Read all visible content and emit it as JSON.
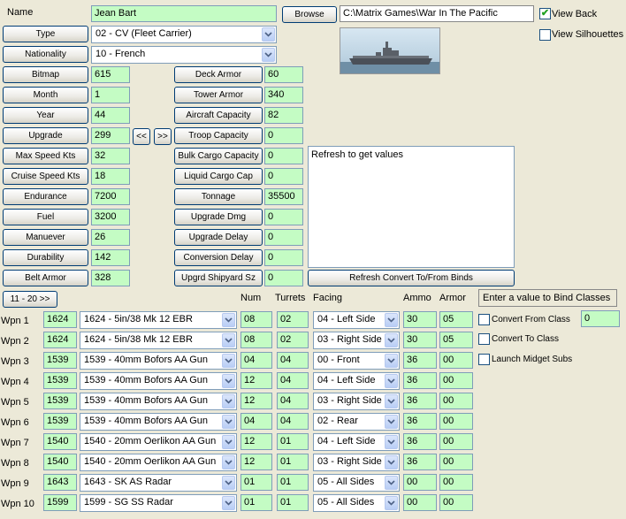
{
  "header": {
    "name_label": "Name",
    "name_value": "Jean Bart",
    "browse_label": "Browse",
    "path_value": "C:\\Matrix Games\\War In The Pacific",
    "view_back_label": "View Back",
    "view_back_checked": true,
    "view_silhouettes_label": "View Silhouettes",
    "view_silhouettes_checked": false
  },
  "type": {
    "label": "Type",
    "value": "02 - CV (Fleet Carrier)"
  },
  "nationality": {
    "label": "Nationality",
    "value": "10 - French"
  },
  "left_fields": [
    {
      "label": "Bitmap",
      "value": "615"
    },
    {
      "label": "Month",
      "value": "1"
    },
    {
      "label": "Year",
      "value": "44"
    },
    {
      "label": "Upgrade",
      "value": "299"
    },
    {
      "label": "Max Speed Kts",
      "value": "32"
    },
    {
      "label": "Cruise Speed Kts",
      "value": "18"
    },
    {
      "label": "Endurance",
      "value": "7200"
    },
    {
      "label": "Fuel",
      "value": "3200"
    },
    {
      "label": "Manuever",
      "value": "26"
    },
    {
      "label": "Durability",
      "value": "142"
    },
    {
      "label": "Belt Armor",
      "value": "328"
    }
  ],
  "upgrade_nav": {
    "prev": "<<",
    "next": ">>"
  },
  "mid_fields": [
    {
      "label": "Deck Armor",
      "value": "60"
    },
    {
      "label": "Tower Armor",
      "value": "340"
    },
    {
      "label": "Aircraft Capacity",
      "value": "82"
    },
    {
      "label": "Troop Capacity",
      "value": "0"
    },
    {
      "label": "Bulk Cargo Capacity",
      "value": "0"
    },
    {
      "label": "Liquid Cargo Cap",
      "value": "0"
    },
    {
      "label": "Tonnage",
      "value": "35500"
    },
    {
      "label": "Upgrade Dmg",
      "value": "0"
    },
    {
      "label": "Upgrade Delay",
      "value": "0"
    },
    {
      "label": "Conversion Delay",
      "value": "0"
    },
    {
      "label": "Upgrd Shipyard Sz",
      "value": "0"
    }
  ],
  "info_box": {
    "text": "Refresh to get values"
  },
  "refresh_button": "Refresh Convert To/From Binds",
  "page_button": "11 - 20 >>",
  "columns": {
    "num": "Num",
    "turrets": "Turrets",
    "facing": "Facing",
    "ammo": "Ammo",
    "armor": "Armor"
  },
  "bind_box": {
    "label": "Enter a value to Bind Classes",
    "convert_from": "Convert From Class",
    "convert_from_value": "0",
    "convert_to": "Convert To Class",
    "launch_midget": "Launch Midget Subs"
  },
  "weapons": [
    {
      "label": "Wpn 1",
      "id": "1624",
      "name": "1624 - 5in/38 Mk 12 EBR",
      "num": "08",
      "turrets": "02",
      "facing": "04 - Left Side",
      "ammo": "30",
      "armor": "05"
    },
    {
      "label": "Wpn 2",
      "id": "1624",
      "name": "1624 - 5in/38 Mk 12 EBR",
      "num": "08",
      "turrets": "02",
      "facing": "03 - Right Side",
      "ammo": "30",
      "armor": "05"
    },
    {
      "label": "Wpn 3",
      "id": "1539",
      "name": "1539 - 40mm Bofors AA Gun",
      "num": "04",
      "turrets": "04",
      "facing": "00 - Front",
      "ammo": "36",
      "armor": "00"
    },
    {
      "label": "Wpn 4",
      "id": "1539",
      "name": "1539 - 40mm Bofors AA Gun",
      "num": "12",
      "turrets": "04",
      "facing": "04 - Left Side",
      "ammo": "36",
      "armor": "00"
    },
    {
      "label": "Wpn 5",
      "id": "1539",
      "name": "1539 - 40mm Bofors AA Gun",
      "num": "12",
      "turrets": "04",
      "facing": "03 - Right Side",
      "ammo": "36",
      "armor": "00"
    },
    {
      "label": "Wpn 6",
      "id": "1539",
      "name": "1539 - 40mm Bofors AA Gun",
      "num": "04",
      "turrets": "04",
      "facing": "02 - Rear",
      "ammo": "36",
      "armor": "00"
    },
    {
      "label": "Wpn 7",
      "id": "1540",
      "name": "1540 - 20mm Oerlikon AA Gun",
      "num": "12",
      "turrets": "01",
      "facing": "04 - Left Side",
      "ammo": "36",
      "armor": "00"
    },
    {
      "label": "Wpn 8",
      "id": "1540",
      "name": "1540 - 20mm Oerlikon AA Gun",
      "num": "12",
      "turrets": "01",
      "facing": "03 - Right Side",
      "ammo": "36",
      "armor": "00"
    },
    {
      "label": "Wpn 9",
      "id": "1643",
      "name": "1643 - SK AS Radar",
      "num": "01",
      "turrets": "01",
      "facing": "05 - All Sides",
      "ammo": "00",
      "armor": "00"
    },
    {
      "label": "Wpn 10",
      "id": "1599",
      "name": "1599 - SG SS Radar",
      "num": "01",
      "turrets": "01",
      "facing": "05 - All Sides",
      "ammo": "00",
      "armor": "00"
    }
  ],
  "colors": {
    "field_green": "#c4fcc4",
    "button_border": "#003c74",
    "background": "#ece9d8"
  }
}
